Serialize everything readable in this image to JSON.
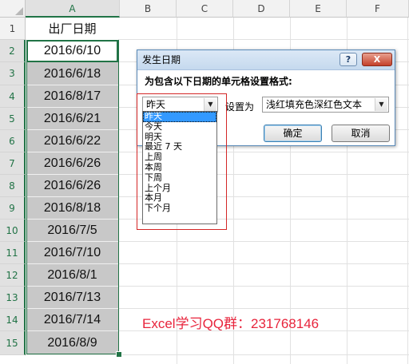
{
  "sheet": {
    "columns": [
      "A",
      "B",
      "C",
      "D",
      "E",
      "F"
    ],
    "rows": [
      "1",
      "2",
      "3",
      "4",
      "5",
      "6",
      "7",
      "8",
      "9",
      "10",
      "11",
      "12",
      "13",
      "14",
      "15"
    ],
    "header_cell": "出厂日期",
    "dates": [
      "2016/6/10",
      "2016/6/18",
      "2016/8/17",
      "2016/6/21",
      "2016/6/22",
      "2016/6/26",
      "2016/6/26",
      "2016/8/18",
      "2016/7/5",
      "2016/7/10",
      "2016/8/1",
      "2016/7/13",
      "2016/7/14",
      "2016/8/9"
    ]
  },
  "dialog": {
    "title": "发生日期",
    "help_label": "?",
    "close_label": "X",
    "prompt": "为包含以下日期的单元格设置格式:",
    "date_selected": "昨天",
    "set_as_label": "设置为",
    "format_selected": "浅红填充色深红色文本",
    "ok_label": "确定",
    "cancel_label": "取消",
    "options": [
      "昨天",
      "今天",
      "明天",
      "最近 7 天",
      "上周",
      "本周",
      "下周",
      "上个月",
      "本月",
      "下个月"
    ]
  },
  "watermark": "Excel学习QQ群：231768146",
  "colors": {
    "accent_green": "#217346",
    "highlight_red": "#d42626",
    "watermark_red": "#e8243c",
    "list_selection": "#3399ff",
    "cell_fill_gray": "#c8c8c8"
  }
}
